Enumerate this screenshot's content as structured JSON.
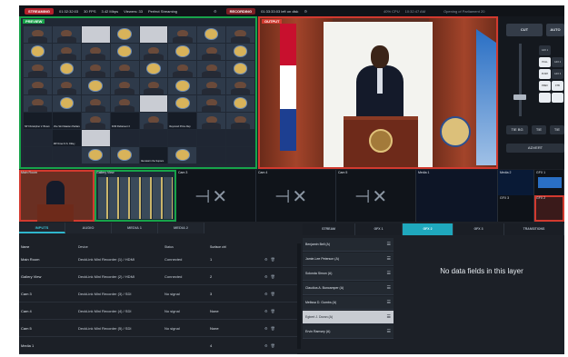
{
  "topbar": {
    "streaming_label": "STREAMING",
    "stream_time": "01:32:32:03",
    "fps": "30 FPS",
    "bitrate": "3.42 Mbps",
    "viewers": "Viewers: 33",
    "stream_status": "Perfect Streaming",
    "recording_label": "RECORDING",
    "record_time": "01:33:33:03 left on disk",
    "cpu": "40% CPU",
    "clock": "10:32:47 AM",
    "session_title": "Opening of Parliament 20"
  },
  "preview": {
    "label": "PREVIEW",
    "tiles": [
      {
        "kind": "person"
      },
      {
        "kind": "person"
      },
      {
        "kind": "light"
      },
      {
        "kind": "seal"
      },
      {
        "kind": "light"
      },
      {
        "kind": "person"
      },
      {
        "kind": "seal"
      },
      {
        "kind": "person"
      },
      {
        "kind": "seal"
      },
      {
        "kind": "person"
      },
      {
        "kind": "person"
      },
      {
        "kind": "seal"
      },
      {
        "kind": "person"
      },
      {
        "kind": "seal"
      },
      {
        "kind": "person"
      },
      {
        "kind": "seal"
      },
      {
        "kind": "person"
      },
      {
        "kind": "seal"
      },
      {
        "kind": "person"
      },
      {
        "kind": "person"
      },
      {
        "kind": "seal"
      },
      {
        "kind": "person"
      },
      {
        "kind": "person"
      },
      {
        "kind": "seal"
      },
      {
        "kind": "person"
      },
      {
        "kind": "person"
      },
      {
        "kind": "seal"
      },
      {
        "kind": "person"
      },
      {
        "kind": "person"
      },
      {
        "kind": "seal"
      },
      {
        "kind": "person"
      },
      {
        "kind": "person"
      },
      {
        "kind": "person"
      },
      {
        "kind": "seal"
      },
      {
        "kind": "person"
      },
      {
        "kind": "person"
      },
      {
        "kind": "light"
      },
      {
        "kind": "seal"
      },
      {
        "kind": "person"
      },
      {
        "kind": "seal"
      },
      {
        "kind": "text",
        "caption": "NP Christopher V. Brown"
      },
      {
        "kind": "text",
        "caption": "Vice Sint Maarten Parliament"
      },
      {
        "kind": "person"
      },
      {
        "kind": "text",
        "caption": "SXM Parliament 3"
      },
      {
        "kind": "person"
      },
      {
        "kind": "text",
        "caption": "Raymond Prime Rep"
      },
      {
        "kind": "person"
      },
      {
        "kind": "person"
      },
      {
        "kind": "dark"
      },
      {
        "kind": "text",
        "caption": "MP Omar O.S. Ottley"
      },
      {
        "kind": "light"
      },
      {
        "kind": "dark"
      },
      {
        "kind": "dark"
      },
      {
        "kind": "dark"
      },
      {
        "kind": "dark"
      },
      {
        "kind": "dark"
      },
      {
        "kind": "dark"
      },
      {
        "kind": "dark"
      },
      {
        "kind": "seal"
      },
      {
        "kind": "seal"
      },
      {
        "kind": "text",
        "caption": "Nkenstorm the Suprem"
      },
      {
        "kind": "seal"
      },
      {
        "kind": "dark"
      },
      {
        "kind": "dark"
      }
    ]
  },
  "output": {
    "label": "OUTPUT"
  },
  "controls": {
    "cut": "CUT",
    "auto": "AUTO",
    "gfx1": "GFX 1",
    "gfx2": "GFX 2",
    "gfx3": "GFX 3",
    "pull": "PULL",
    "push": "PUSH",
    "prev": "PREV",
    "ftb": "FTB",
    "tie_bg": "TIE BG",
    "tie": "TIE",
    "advert": "ADVERT"
  },
  "sources": {
    "main_room": "Main Room",
    "gallery_view": "Gallery View",
    "cam3": "Cam 3",
    "cam4": "Cam 4",
    "cam5": "Cam 5",
    "media1": "Media 1",
    "media2": "Media 2",
    "gfx1": "GFX 1",
    "gfx3": "GFX 3",
    "gfx2": "GFX 2"
  },
  "tabs": [
    "INPUTS",
    "AUDIO",
    "MEDIA 1",
    "MEDIA 2"
  ],
  "table": {
    "headers": [
      "Name",
      "Device",
      "Status",
      "Surface ctrl"
    ],
    "rows": [
      {
        "name": "Main Room",
        "device": "DeckLink Mini Recorder (1) / HDMI",
        "status": "Connected",
        "ctrl": "1"
      },
      {
        "name": "Gallery View",
        "device": "DeckLink Mini Recorder (2) / HDMI",
        "status": "Connected",
        "ctrl": "2"
      },
      {
        "name": "Cam 3",
        "device": "DeckLink Mini Recorder (3) / SDI",
        "status": "No signal",
        "ctrl": "3"
      },
      {
        "name": "Cam 4",
        "device": "DeckLink Mini Recorder (4) / SDI",
        "status": "No signal",
        "ctrl": "None"
      },
      {
        "name": "Cam 5",
        "device": "DeckLink Mini Recorder (5) / SDI",
        "status": "No signal",
        "ctrl": "None"
      },
      {
        "name": "Media 1",
        "device": "",
        "status": "",
        "ctrl": "4"
      }
    ]
  },
  "gfx_tabs": [
    "STREAM",
    "GFX 1",
    "GFX 2",
    "GFX 3",
    "TRANSITIONS"
  ],
  "names": [
    "Benjamin Bell (A)",
    "Jamie-Lee Peterson (A)",
    "Solonda Simon (A)",
    "Claudius A. Buncamper (A)",
    "Melissa D. Gumbs (A)",
    "Egbert J. Doran (A)",
    "Ervin Ramsey (A)"
  ],
  "selected_name_index": 5,
  "nodata_text": "No data fields in this layer",
  "colors": {
    "program": "#d23a2f",
    "preview": "#17a34a",
    "accent": "#1fa8bd"
  }
}
